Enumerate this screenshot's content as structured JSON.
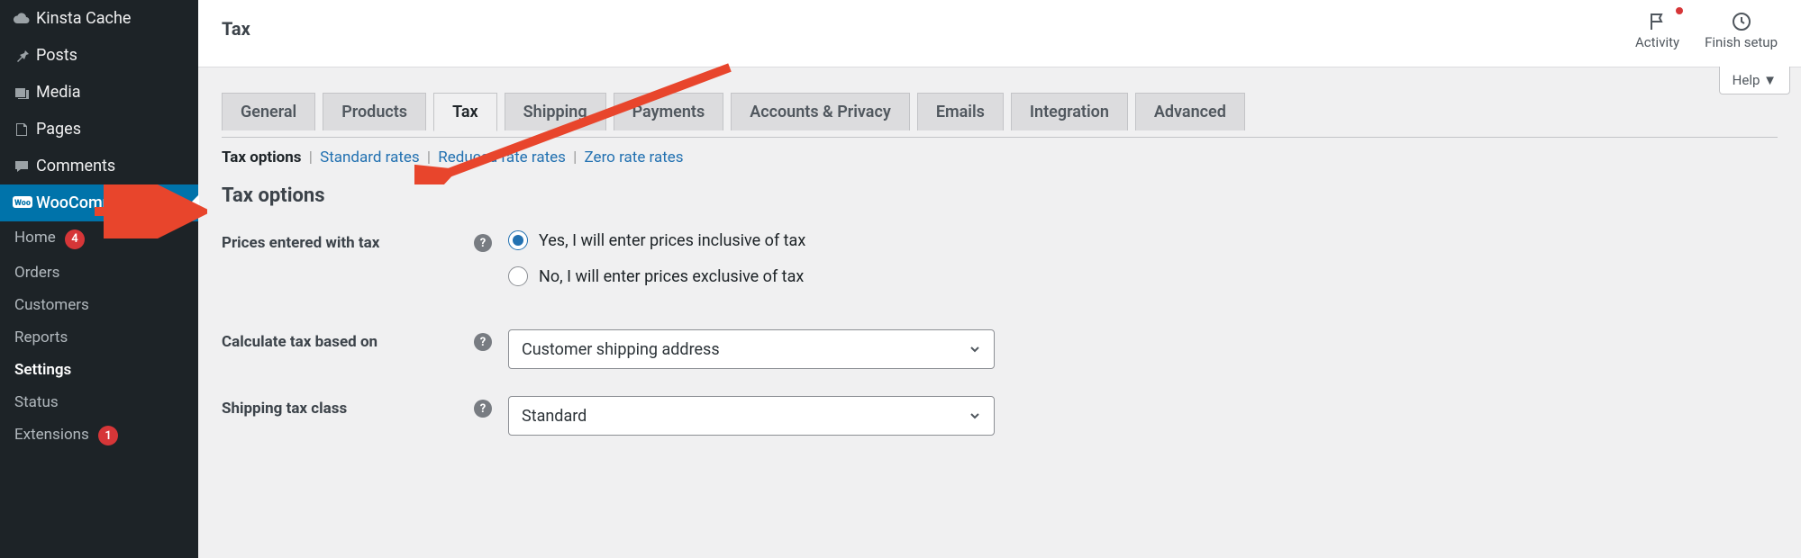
{
  "sidebar": {
    "top_items": [
      {
        "icon": "cloud",
        "label": "Kinsta Cache"
      },
      {
        "icon": "pin",
        "label": "Posts"
      },
      {
        "icon": "media",
        "label": "Media"
      },
      {
        "icon": "page",
        "label": "Pages"
      },
      {
        "icon": "comment",
        "label": "Comments"
      }
    ],
    "active": {
      "icon": "woo",
      "label": "WooCommerce"
    },
    "sub_items": [
      {
        "label": "Home",
        "badge": "4"
      },
      {
        "label": "Orders"
      },
      {
        "label": "Customers"
      },
      {
        "label": "Reports"
      },
      {
        "label": "Settings",
        "active": true
      },
      {
        "label": "Status"
      },
      {
        "label": "Extensions",
        "badge": "1"
      }
    ]
  },
  "header": {
    "title": "Tax",
    "actions": {
      "activity": "Activity",
      "finish": "Finish setup"
    },
    "help": "Help"
  },
  "tabs": [
    "General",
    "Products",
    "Tax",
    "Shipping",
    "Payments",
    "Accounts & Privacy",
    "Emails",
    "Integration",
    "Advanced"
  ],
  "active_tab": "Tax",
  "subtabs": {
    "current": "Tax options",
    "links": [
      "Standard rates",
      "Reduced rate rates",
      "Zero rate rates"
    ]
  },
  "section_heading": "Tax options",
  "fields": {
    "prices": {
      "label": "Prices entered with tax",
      "opt1": "Yes, I will enter prices inclusive of tax",
      "opt2": "No, I will enter prices exclusive of tax",
      "selected": 0
    },
    "calc": {
      "label": "Calculate tax based on",
      "value": "Customer shipping address"
    },
    "ship": {
      "label": "Shipping tax class",
      "value": "Standard"
    }
  }
}
